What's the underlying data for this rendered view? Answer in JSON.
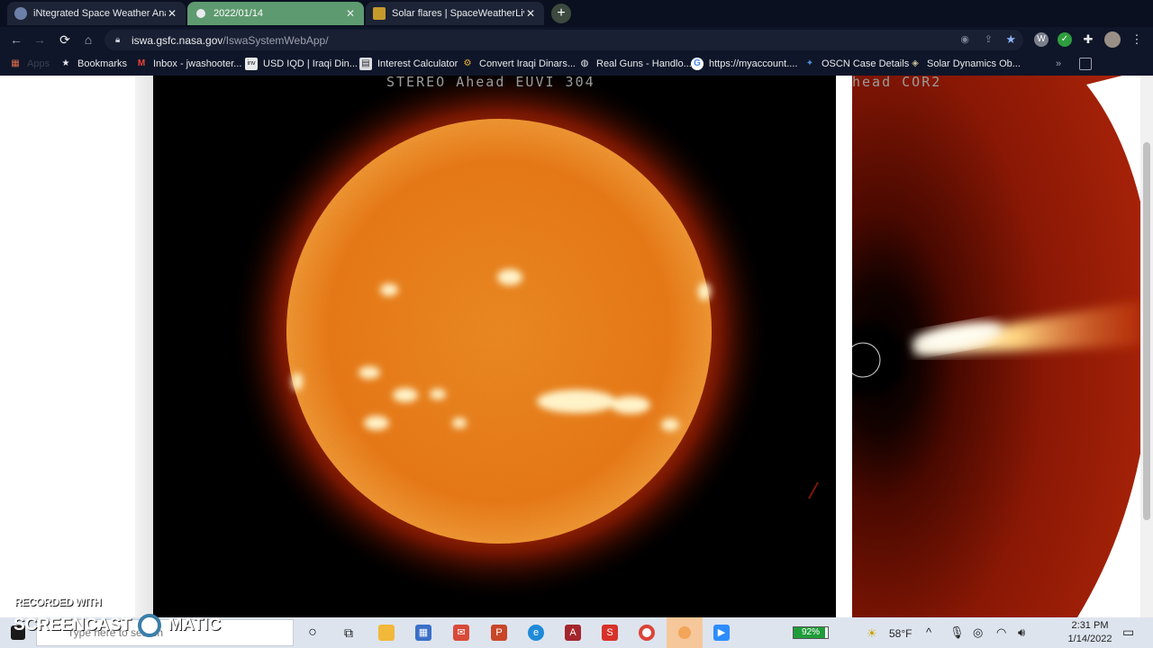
{
  "browser": {
    "tabs": [
      {
        "label": "iNtegrated Space Weather Analy",
        "active": false
      },
      {
        "label": "2022/01/14",
        "active": true
      },
      {
        "label": "Solar flares | SpaceWeatherLive.c",
        "active": false
      }
    ],
    "close_glyph": "✕",
    "new_tab_glyph": "+",
    "nav": {
      "back_glyph": "←",
      "forward_glyph": "→",
      "reload_glyph": "⟳",
      "home_glyph": "⌂"
    },
    "url": {
      "host": "iswa.gsfc.nasa.gov",
      "path": "/IswaSystemWebApp/"
    },
    "bookmarks": [
      {
        "label": "Apps",
        "icon": "apps-grid-icon"
      },
      {
        "label": "Bookmarks",
        "icon": "star-icon"
      },
      {
        "label": "Inbox - jwashooter...",
        "icon": "gmail-icon"
      },
      {
        "label": "USD IQD | Iraqi Din...",
        "icon": "inv-icon"
      },
      {
        "label": "Interest Calculator",
        "icon": "calculator-icon"
      },
      {
        "label": "Convert Iraqi Dinars...",
        "icon": "currency-icon"
      },
      {
        "label": "Real Guns - Handlo...",
        "icon": "globe-icon"
      },
      {
        "label": "https://myaccount....",
        "icon": "google-icon"
      },
      {
        "label": "OSCN Case Details",
        "icon": "oscn-icon"
      },
      {
        "label": "Solar Dynamics Ob...",
        "icon": "sdo-icon"
      }
    ],
    "more_bookmarks": "»"
  },
  "page": {
    "panel1_label": "STEREO Ahead EUVI 304",
    "panel2_label": "head COR2"
  },
  "taskbar": {
    "search_placeholder": "Type here to search",
    "battery_percent": 92,
    "battery_label": "92%",
    "weather": "58°F",
    "time": "2:31 PM",
    "date": "1/14/2022",
    "apps": [
      "cortana-circle-icon",
      "task-view-icon",
      "file-explorer-icon",
      "microsoft-store-icon",
      "mail-icon",
      "powerpoint-icon",
      "edge-icon",
      "access-icon",
      "stumbleupon-icon",
      "chrome-icon",
      "recorder-icon",
      "zoom-icon"
    ]
  },
  "watermark": {
    "line1": "RECORDED WITH",
    "line2": "SCREENCAST",
    "line3": "MATIC"
  },
  "colors": {
    "sun_core": "#f07a12",
    "sun_corona": "#c22a04",
    "cor2_bg": "#6e0d02"
  }
}
